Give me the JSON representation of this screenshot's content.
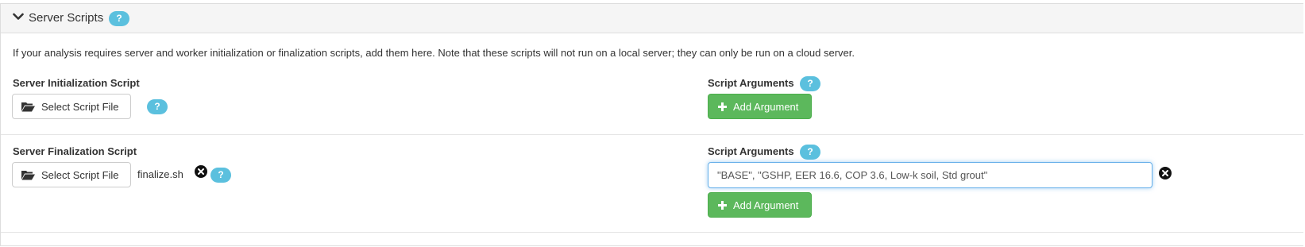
{
  "panel": {
    "title": "Server Scripts",
    "help_label": "?",
    "description": "If your analysis requires server and worker initialization or finalization scripts, add them here. Note that these scripts will not run on a local server; they can only be run on a cloud server."
  },
  "init_section": {
    "label": "Server Initialization Script",
    "select_button": "Select Script File",
    "help_label": "?",
    "args_label": "Script Arguments",
    "args_help_label": "?",
    "add_argument_button": "Add Argument"
  },
  "final_section": {
    "label": "Server Finalization Script",
    "select_button": "Select Script File",
    "file_name": "finalize.sh",
    "help_label": "?",
    "args_label": "Script Arguments",
    "args_help_label": "?",
    "argument_value": "\"BASE\", \"GSHP, EER 16.6, COP 3.6, Low-k soil, Std grout\"",
    "add_argument_button": "Add Argument"
  },
  "colors": {
    "info_badge": "#5bc0de",
    "success": "#5cb85c",
    "focus_border": "#66afe9",
    "heading_bg": "#f5f5f5"
  },
  "icons": {
    "collapse": "chevron-down-icon",
    "folder": "folder-open-icon",
    "plus": "plus-icon",
    "remove": "remove-circle-icon"
  }
}
